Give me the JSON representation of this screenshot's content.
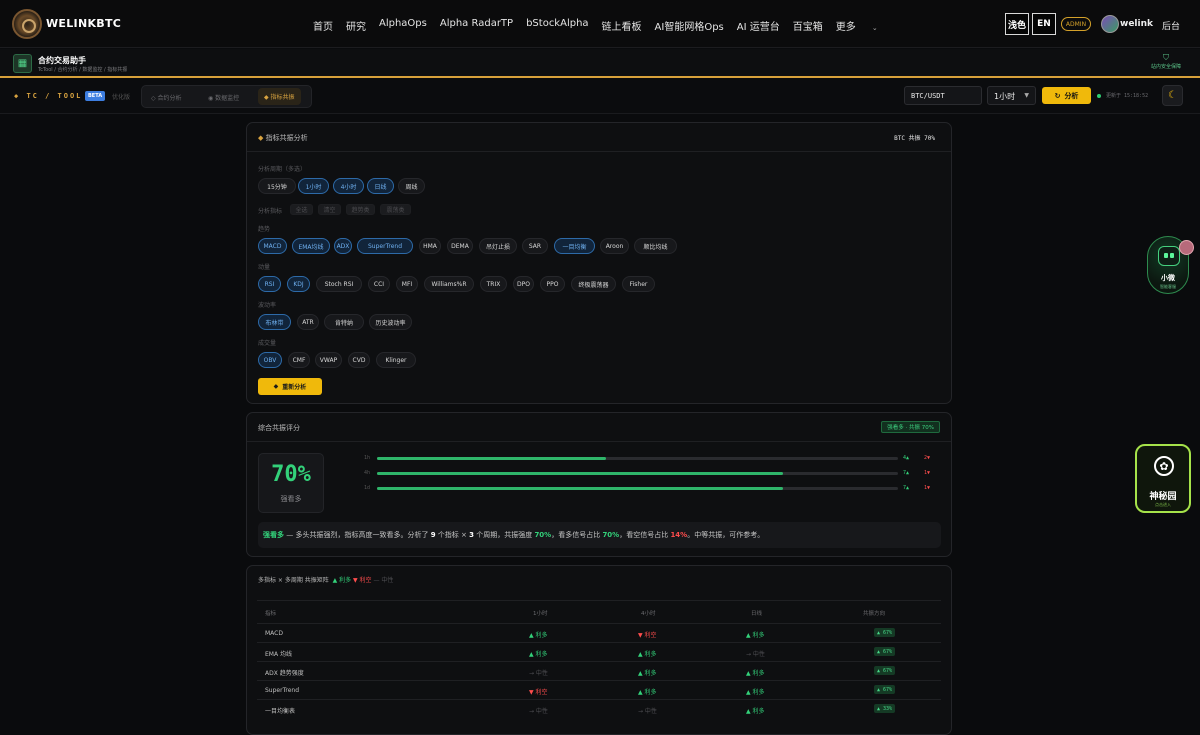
{
  "nav": {
    "brand": "WELINKBTC",
    "links": [
      "首页",
      "研究",
      "AlphaOps",
      "Alpha RadarTP",
      "bStockAlpha",
      "链上看板",
      "AI智能网格Ops",
      "AI 运营台",
      "百宝箱",
      "更多"
    ],
    "theme_btn": "浅色",
    "lang_btn": "EN",
    "admin_badge": "ADMIN",
    "username": "welink",
    "backend": "后台"
  },
  "subheader": {
    "title": "合约交易助手",
    "breadcrumb": "TcTool / 合约分析 / 数据监控 / 指标共振",
    "safe_label": "站内安全保障"
  },
  "toolbar": {
    "brand": "TC / TOOL",
    "beta": "BETA",
    "optimizing": "优化版",
    "tabs": [
      "合约分析",
      "数据监控",
      "指标共振"
    ],
    "pair": "BTC/USDT",
    "timeframe": "1小时",
    "analyze_btn": "分析",
    "updated": "更新于 15:18:52",
    "accent": "#f0b90b"
  },
  "resonance": {
    "title": "指标共振分析",
    "status": "BTC 共振 70%",
    "period_label": "分析周期（多选）",
    "periods": [
      "15分钟",
      "1小时",
      "4小时",
      "日线",
      "周线"
    ],
    "indicator_label": "分析指标",
    "indicator_dims": [
      "全选",
      "清空",
      "趋势类",
      "震荡类"
    ],
    "group_trend": "趋势",
    "trend": [
      "MACD",
      "EMA均线",
      "ADX",
      "SuperTrend",
      "HMA",
      "DEMA",
      "吊灯止损",
      "SAR",
      "一目均衡",
      "Aroon",
      "顺比均线"
    ],
    "group_osc": "动量",
    "osc": [
      "RSI",
      "KDJ",
      "Stoch RSI",
      "CCI",
      "MFI",
      "Williams%R",
      "TRIX",
      "DPO",
      "PPO",
      "终极震荡器",
      "Fisher"
    ],
    "group_vol": "波动率",
    "vol": [
      "布林带",
      "ATR",
      "肯特纳",
      "历史波动率"
    ],
    "group_volume": "成交量",
    "volume": [
      "OBV",
      "CMF",
      "VWAP",
      "CVD",
      "Klinger"
    ],
    "reanalyze_btn": "重新分析"
  },
  "score": {
    "title": "综合共振评分",
    "tag": "强看多 · 共振 70%",
    "value": "70%",
    "verdict": "强看多",
    "bars": [
      {
        "label": "1h",
        "fill": 0.44,
        "up": "4▲",
        "down": "2▼"
      },
      {
        "label": "4h",
        "fill": 0.78,
        "up": "7▲",
        "down": "1▼"
      },
      {
        "label": "1d",
        "fill": 0.78,
        "up": "7▲",
        "down": "1▼"
      }
    ],
    "summary": {
      "verdict": "强看多",
      "t1": " — 多头共振强烈，指标高度一致看多。分析了 ",
      "n_ind": "9",
      "t2": " 个指标 × ",
      "n_per": "3",
      "t3": " 个周期，共振强度 ",
      "strength": "70%",
      "t4": "，看多信号占比 ",
      "bull": "70%",
      "t5": "，看空信号占比 ",
      "bear": "14%",
      "t6": "。中等共振，可作参考。"
    }
  },
  "matrix": {
    "title": "多指标 × 多周期 共振矩阵",
    "legend_up": "▲ 利多",
    "legend_down": "▼ 利空",
    "legend_neutral": "— 中性",
    "headers": [
      "指标",
      "1小时",
      "4小时",
      "日线",
      "共振方向"
    ],
    "rows": [
      {
        "name": "MACD",
        "c": [
          [
            "up",
            "▲ 利多"
          ],
          [
            "dn",
            "▼ 利空"
          ],
          [
            "up",
            "▲ 利多"
          ]
        ],
        "pct": "▲ 67%"
      },
      {
        "name": "EMA 均线",
        "c": [
          [
            "up",
            "▲ 利多"
          ],
          [
            "up",
            "▲ 利多"
          ],
          [
            "nt",
            "→ 中性"
          ]
        ],
        "pct": "▲ 67%"
      },
      {
        "name": "ADX 趋势强度",
        "c": [
          [
            "nt",
            "→ 中性"
          ],
          [
            "up",
            "▲ 利多"
          ],
          [
            "up",
            "▲ 利多"
          ]
        ],
        "pct": "▲ 67%"
      },
      {
        "name": "SuperTrend",
        "c": [
          [
            "dn",
            "▼ 利空"
          ],
          [
            "up",
            "▲ 利多"
          ],
          [
            "up",
            "▲ 利多"
          ]
        ],
        "pct": "▲ 67%"
      },
      {
        "name": "一目均衡表",
        "c": [
          [
            "nt",
            "→ 中性"
          ],
          [
            "nt",
            "→ 中性"
          ],
          [
            "up",
            "▲ 利多"
          ]
        ],
        "pct": "▲ 33%"
      }
    ]
  },
  "floats": {
    "assistant": "小微",
    "assistant_sub": "智能客服",
    "garden": "神秘园",
    "garden_sub": "点击进入"
  }
}
